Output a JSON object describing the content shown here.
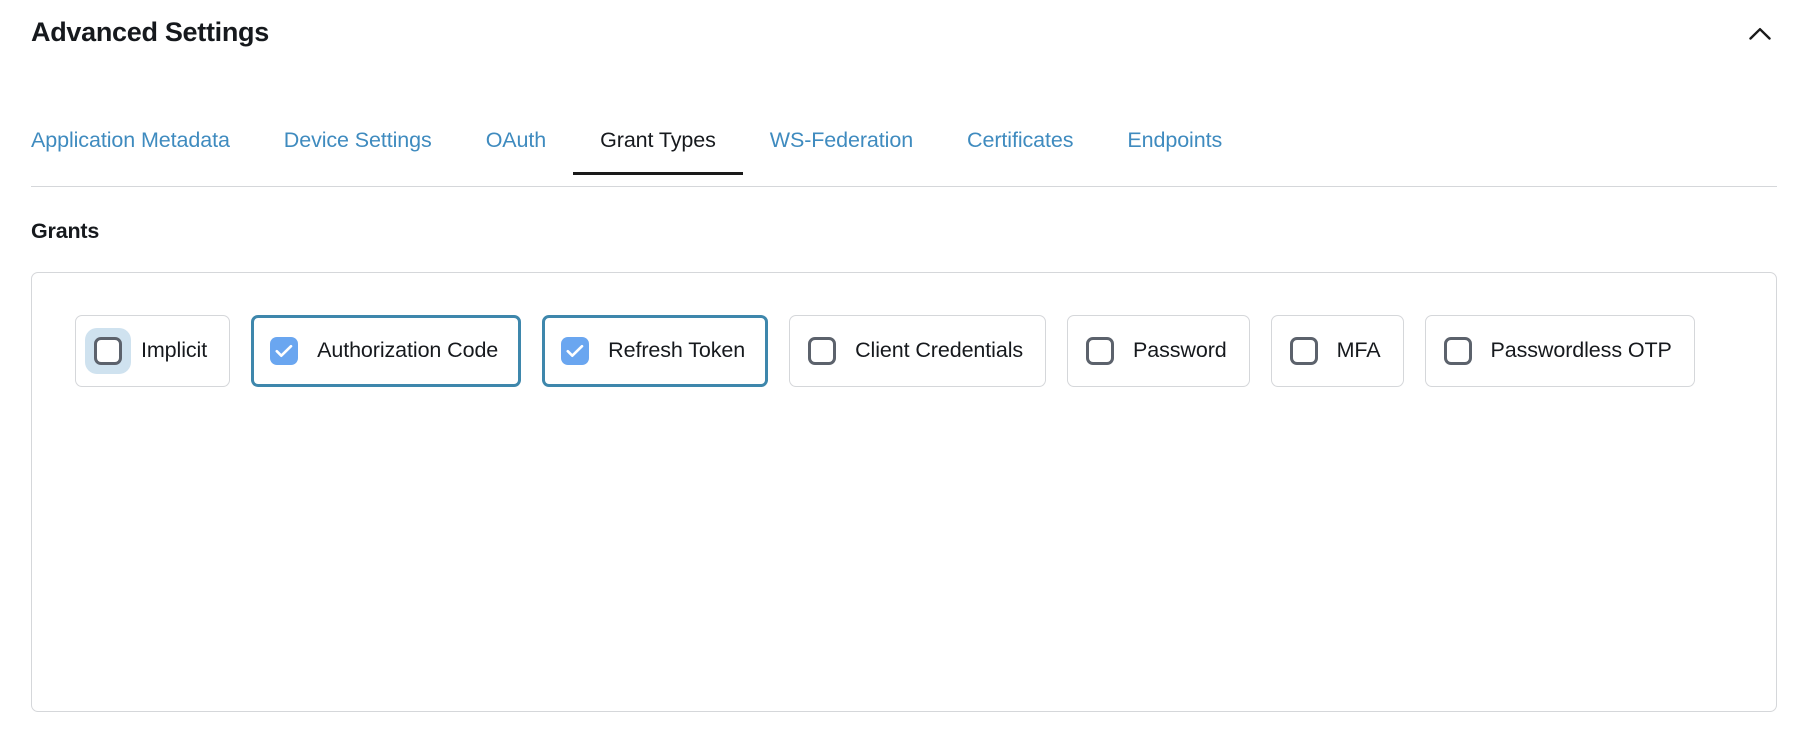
{
  "header": {
    "title": "Advanced Settings",
    "collapse_icon": "chevron-up-icon"
  },
  "tabs": [
    {
      "label": "Application Metadata",
      "active": false
    },
    {
      "label": "Device Settings",
      "active": false
    },
    {
      "label": "OAuth",
      "active": false
    },
    {
      "label": "Grant Types",
      "active": true
    },
    {
      "label": "WS-Federation",
      "active": false
    },
    {
      "label": "Certificates",
      "active": false
    },
    {
      "label": "Endpoints",
      "active": false
    }
  ],
  "grants": {
    "section_title": "Grants",
    "items": [
      {
        "label": "Implicit",
        "checked": false,
        "focused": true
      },
      {
        "label": "Authorization Code",
        "checked": true,
        "focused": false
      },
      {
        "label": "Refresh Token",
        "checked": true,
        "focused": false
      },
      {
        "label": "Client Credentials",
        "checked": false,
        "focused": false
      },
      {
        "label": "Password",
        "checked": false,
        "focused": false
      },
      {
        "label": "MFA",
        "checked": false,
        "focused": false
      },
      {
        "label": "Passwordless OTP",
        "checked": false,
        "focused": false
      }
    ]
  },
  "colors": {
    "link": "#3f8bbf",
    "active_tab_underline": "#1a1a1a",
    "checked_border": "#3e87ac",
    "checkbox_fill": "#6aa6f0",
    "checkbox_outline": "#5c626c",
    "focus_halo": "#cfe2ef",
    "panel_border": "#d5d7da",
    "text": "#16191d"
  }
}
